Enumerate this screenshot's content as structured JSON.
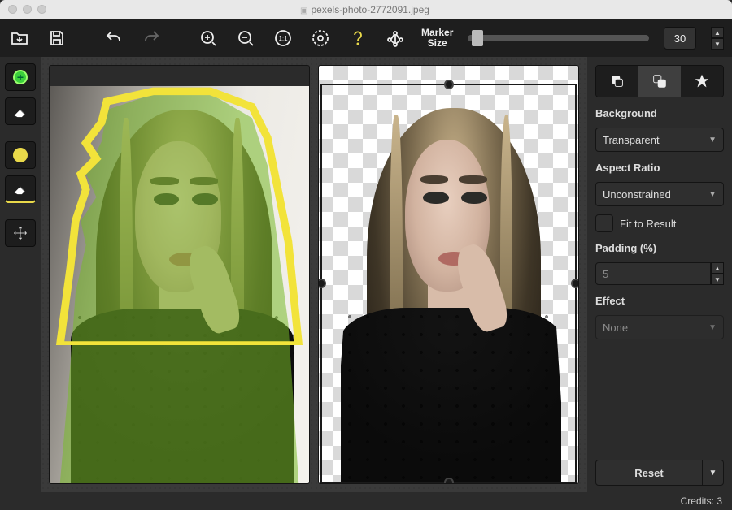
{
  "titlebar": {
    "filename": "pexels-photo-2772091.jpeg"
  },
  "toolbar": {
    "marker_label": "Marker\nSize",
    "marker_value": "30"
  },
  "tools": {
    "add": "add-marker",
    "erase": "eraser",
    "foreground": "foreground-marker",
    "erase2": "eraser-2",
    "move": "move-tool"
  },
  "sidebar": {
    "background_label": "Background",
    "background_value": "Transparent",
    "aspect_label": "Aspect Ratio",
    "aspect_value": "Unconstrained",
    "fit_label": "Fit to Result",
    "padding_label": "Padding (%)",
    "padding_value": "5",
    "effect_label": "Effect",
    "effect_value": "None",
    "reset_label": "Reset"
  },
  "status": {
    "credits_label": "Credits: 3"
  }
}
